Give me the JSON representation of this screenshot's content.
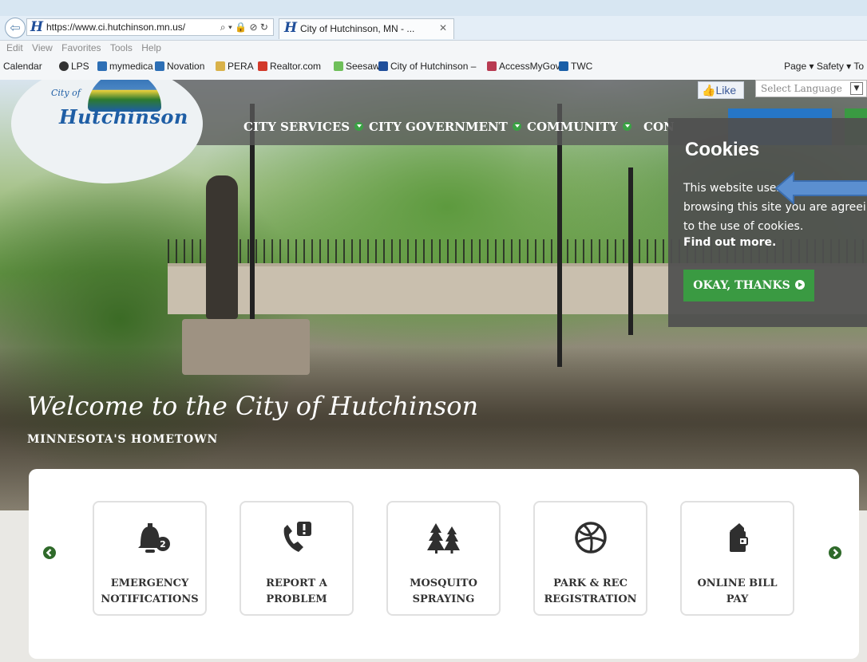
{
  "browser": {
    "url": "https://www.ci.hutchinson.mn.us/",
    "tab_title": "City of Hutchinson, MN - ...",
    "menu": [
      "Edit",
      "View",
      "Favorites",
      "Tools",
      "Help"
    ],
    "favorites": [
      "Calendar",
      "LPS",
      "mymedica",
      "Novation",
      "PERA",
      "Realtor.com",
      "Seesaw",
      "City of Hutchinson –",
      "AccessMyGov",
      "TWC"
    ],
    "command_bar": "Page ▾  Safety ▾  To"
  },
  "site": {
    "logo_city": "City of",
    "logo_word": "Hutchinson",
    "nav": [
      "CITY SERVICES",
      "CITY GOVERNMENT",
      "COMMUNITY",
      "CON"
    ],
    "like_label": "Like",
    "language_placeholder": "Select Language",
    "hero_title": "Welcome to the City of Hutchinson",
    "hero_subtitle": "MINNESOTA'S HOMETOWN"
  },
  "cookies": {
    "title": "Cookies",
    "text": "This website uses cookies. By browsing this site you are agreei to the use of cookies.",
    "find_more": "Find out more.",
    "ok": "OKAY, THANKS"
  },
  "quicklinks": [
    {
      "l1": "EMERGENCY",
      "l2": "NOTIFICATIONS",
      "icon": "bell-icon",
      "badge": "2"
    },
    {
      "l1": "REPORT A",
      "l2": "PROBLEM",
      "icon": "phone-alert-icon"
    },
    {
      "l1": "MOSQUITO",
      "l2": "SPRAYING",
      "icon": "trees-icon"
    },
    {
      "l1": "PARK & REC",
      "l2": "REGISTRATION",
      "icon": "volleyball-icon"
    },
    {
      "l1": "ONLINE BILL",
      "l2": "PAY",
      "icon": "wallet-icon"
    }
  ],
  "colors": {
    "accent_green": "#3a9a42",
    "brand_blue": "#1e5ea5",
    "annotation_arrow": "#5b8fd0"
  }
}
